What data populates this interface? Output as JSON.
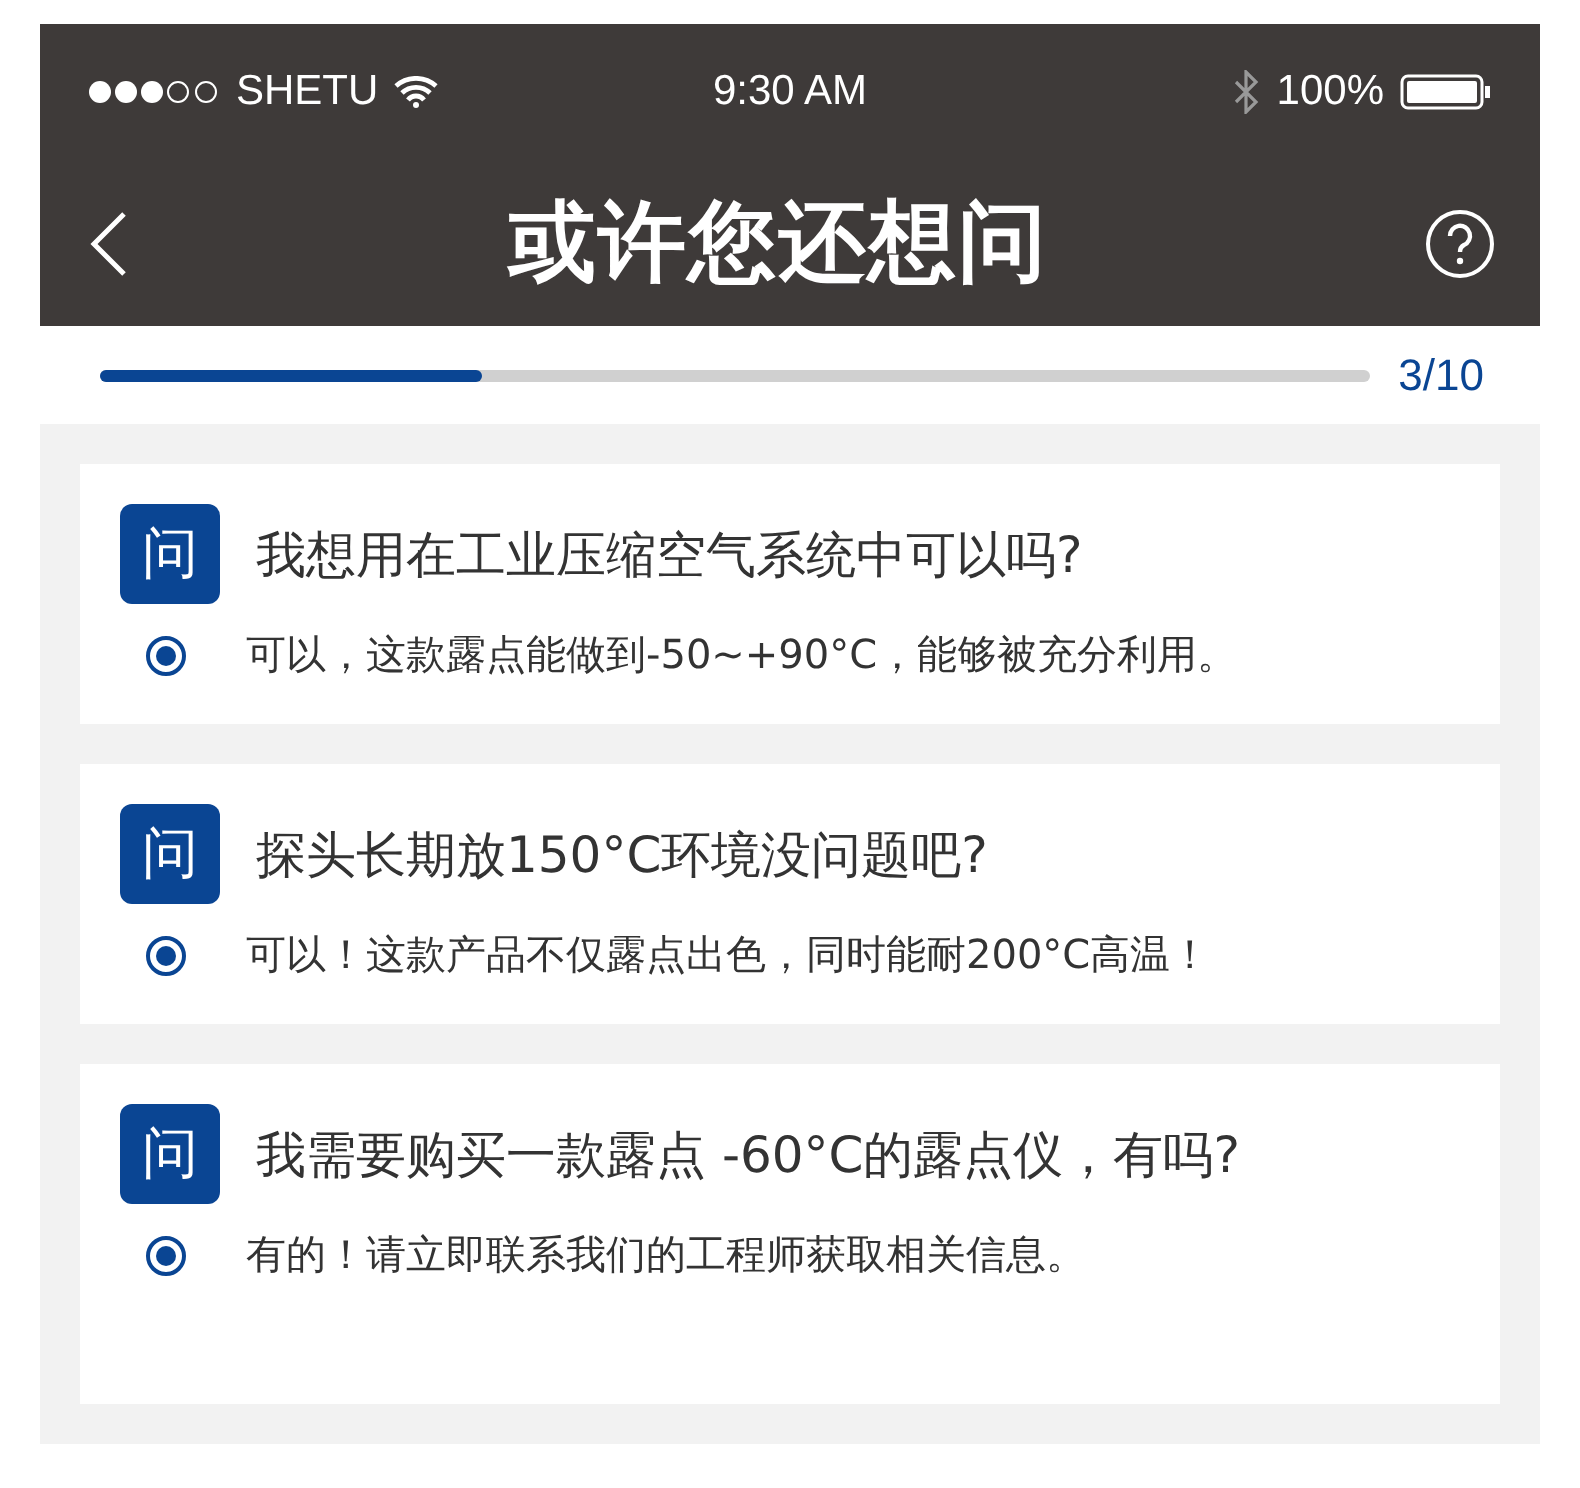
{
  "status_bar": {
    "carrier": "SHETU",
    "time": "9:30 AM",
    "battery": "100%"
  },
  "header": {
    "title": "或许您还想问"
  },
  "progress": {
    "level": 0.3,
    "label": "3/10"
  },
  "questions": [
    {
      "badge": "问",
      "question": "我想用在工业压缩空气系统中可以吗?",
      "answer": "可以，这款露点能做到-50~+90°C，能够被充分利用。",
      "selected": true
    },
    {
      "badge": "问",
      "question": "探头长期放150°C环境没问题吧?",
      "answer": "可以！这款产品不仅露点出色，同时能耐200°C高温！",
      "selected": true
    },
    {
      "badge": "问",
      "question": "我需要购买一款露点 -60°C的露点仪，有吗?",
      "answer": "有的！请立即联系我们的工程师获取相关信息。",
      "selected": true
    }
  ]
}
